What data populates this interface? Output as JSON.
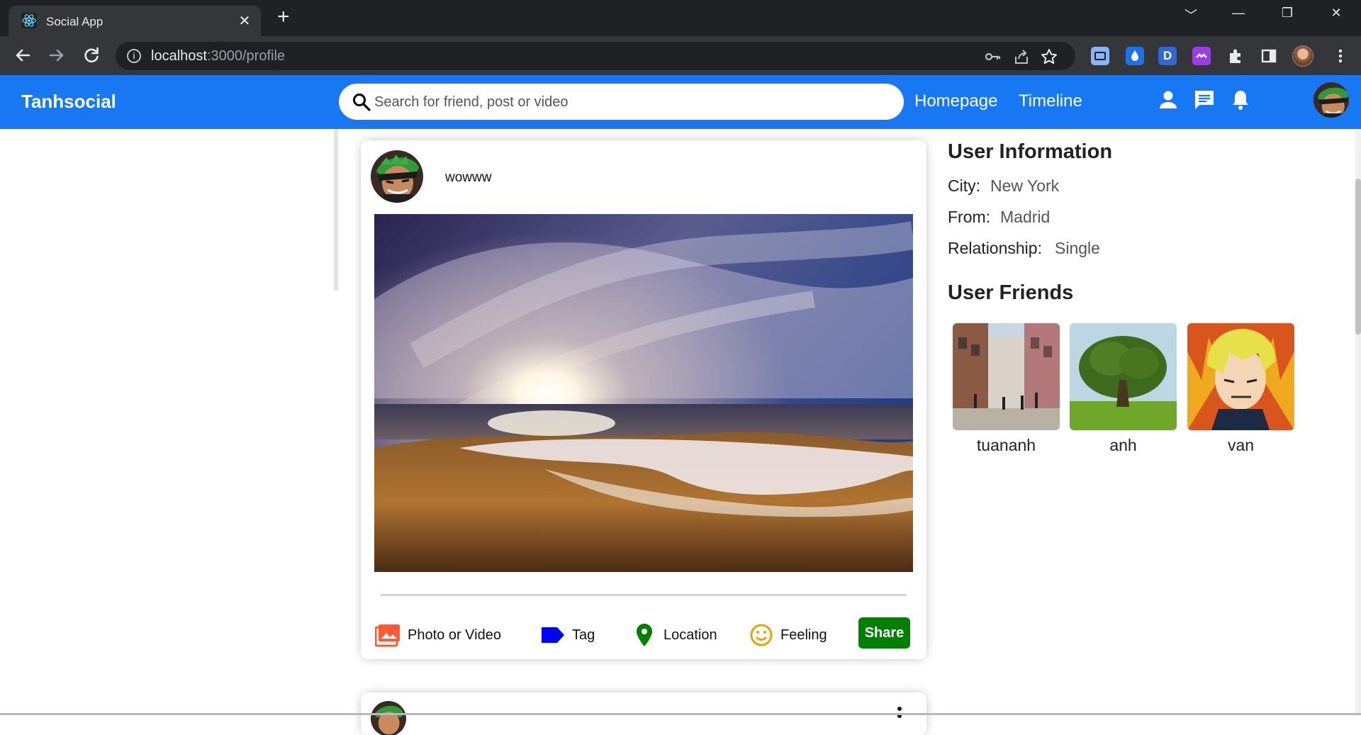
{
  "browser": {
    "tab_title": "Social App",
    "tab_close": "✕",
    "new_tab": "+",
    "url_host": "localhost",
    "url_path": ":3000/profile",
    "window_controls": [
      "﹀",
      "—",
      "❐",
      "✕"
    ],
    "extension_letter": "D"
  },
  "topbar": {
    "logo": "Tanhsocial",
    "search_placeholder": "Search for friend, post or video",
    "links": [
      "Homepage",
      "Timeline"
    ],
    "icons": [
      "person-icon",
      "chat-icon",
      "notifications-icon"
    ]
  },
  "post": {
    "text": "wowww",
    "options": [
      {
        "label": "Photo or Video",
        "icon": "photo-icon",
        "color": "#ff5a36"
      },
      {
        "label": "Tag",
        "icon": "label-icon",
        "color": "#0000ff"
      },
      {
        "label": "Location",
        "icon": "location-icon",
        "color": "#008000"
      },
      {
        "label": "Feeling",
        "icon": "emoji-icon",
        "color": "#e8a400"
      }
    ],
    "share_label": "Share"
  },
  "rightbar": {
    "info_title": "User Information",
    "city_label": "City:",
    "city": "New York",
    "from_label": "From:",
    "from": "Madrid",
    "relationship_label": "Relationship:",
    "relationship": "Single",
    "friends_title": "User Friends",
    "friends": [
      {
        "name": "tuananh"
      },
      {
        "name": "anh"
      },
      {
        "name": "van"
      }
    ]
  },
  "colors": {
    "brand": "#1877f2",
    "share": "#008000"
  }
}
